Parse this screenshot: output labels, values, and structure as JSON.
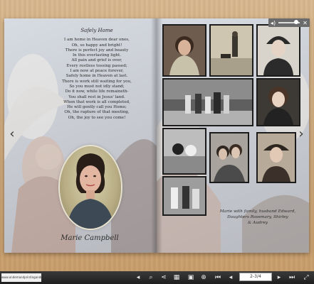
{
  "poem": {
    "title": "Safely Home",
    "lines": [
      "I am home in Heaven dear ones,",
      "Oh, so happy and bright!",
      "There is perfect joy and beauty",
      "In this everlasting light.",
      "All pain and grief is over,",
      "Every restless tossing passed;",
      "I am now at peace forever,",
      "Safely home in Heaven at last.",
      "There is work still waiting for you,",
      "So you must not idly stand;",
      "Do it now, while life remaineth-",
      "You shall rest in Jesus' land.",
      "When that work is all completed,",
      "He will gently call you Home;",
      "Oh, the rapture of that meeting,",
      "Oh, the joy to see you come!"
    ]
  },
  "portrait": {
    "name": "Marie Campbell"
  },
  "right_page": {
    "caption_line1": "Marie with family, husband Edward,",
    "caption_line2": "Daughters Rosemary, Shirley",
    "caption_line3": "& Audrey"
  },
  "toolbar": {
    "logo_text": "www.ondemandprintingandnews.com",
    "page_indicator": "2-3/4"
  },
  "colors": {
    "toolbar_bg": "#262626",
    "page_bg": "#cfd2d8"
  },
  "icons": {
    "volume": "volume-icon",
    "close": "close-icon",
    "sound": "sound-icon",
    "zoom": "zoom-icon",
    "share": "share-icon",
    "thumbnails": "grid-icon",
    "print": "print-icon",
    "zoom_in": "zoom-in-icon",
    "first": "first-page-icon",
    "prev": "prev-page-icon",
    "next": "next-page-icon",
    "last": "last-page-icon",
    "fullscreen": "fullscreen-icon"
  }
}
